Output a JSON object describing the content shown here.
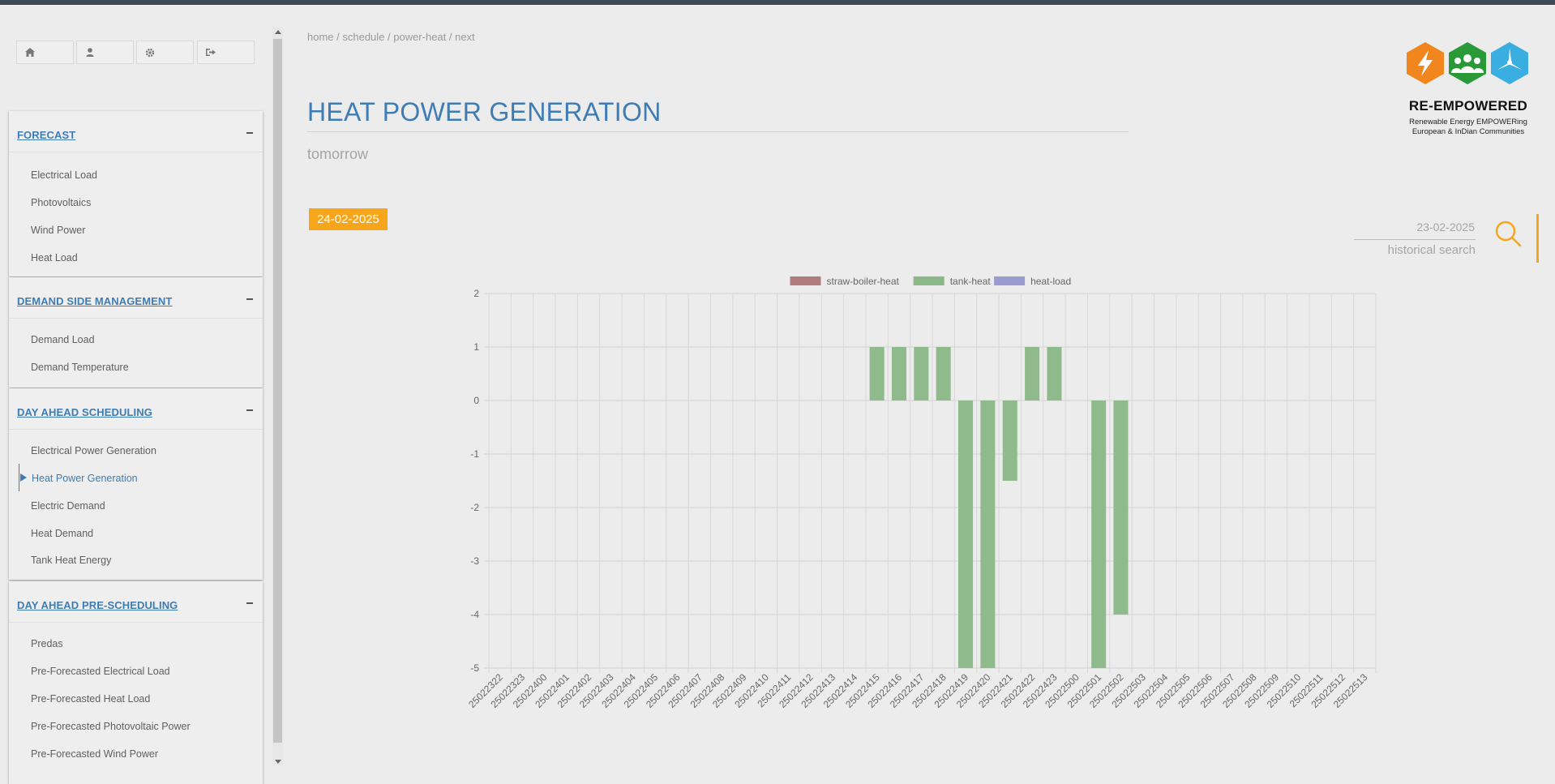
{
  "toolbar": {
    "buttons": [
      {
        "icon": "home-icon"
      },
      {
        "icon": "user-icon"
      },
      {
        "icon": "gear-icon"
      },
      {
        "icon": "sign-out-icon"
      }
    ]
  },
  "sidebar": {
    "sections": [
      {
        "title": "FORECAST",
        "items": [
          "Electrical Load",
          "Photovoltaics",
          "Wind Power",
          "Heat Load"
        ]
      },
      {
        "title": "DEMAND SIDE MANAGEMENT",
        "items": [
          "Demand Load",
          "Demand Temperature"
        ]
      },
      {
        "title": "DAY AHEAD SCHEDULING",
        "items": [
          "Electrical Power Generation",
          "Heat Power Generation",
          "Electric Demand",
          "Heat Demand",
          "Tank Heat Energy"
        ],
        "active": "Heat Power Generation"
      },
      {
        "title": "DAY AHEAD PRE-SCHEDULING",
        "items": [
          "Predas",
          "Pre-Forecasted Electrical Load",
          "Pre-Forecasted Heat Load",
          "Pre-Forecasted Photovoltaic Power",
          "Pre-Forecasted Wind Power"
        ]
      }
    ],
    "toggle_symbol": "−"
  },
  "breadcrumb": "home / schedule / power-heat / next",
  "page": {
    "title": "HEAT POWER GENERATION",
    "subtitle": "tomorrow",
    "date_badge": "24-02-2025"
  },
  "logo": {
    "name": "RE-EMPOWERED",
    "tagline_1": "Renewable Energy EMPOWERing",
    "tagline_2": "European & InDian Communities",
    "colors": [
      "#f0861d",
      "#2a9a38",
      "#3aaee0"
    ]
  },
  "historical": {
    "date": "23-02-2025",
    "label": "historical search",
    "accent": "#f7a51a"
  },
  "chart_data": {
    "type": "bar",
    "ylim": [
      -5,
      2
    ],
    "yticks": [
      2,
      1,
      0,
      -1,
      -2,
      -3,
      -4,
      -5
    ],
    "grid": true,
    "legend_position": "top",
    "categories": [
      "25022322",
      "25022323",
      "25022400",
      "25022401",
      "25022402",
      "25022403",
      "25022404",
      "25022405",
      "25022406",
      "25022407",
      "25022408",
      "25022409",
      "25022410",
      "25022411",
      "25022412",
      "25022413",
      "25022414",
      "25022415",
      "25022416",
      "25022417",
      "25022418",
      "25022419",
      "25022420",
      "25022421",
      "25022422",
      "25022423",
      "25022500",
      "25022501",
      "25022502",
      "25022503",
      "25022504",
      "25022505",
      "25022506",
      "25022507",
      "25022508",
      "25022509",
      "25022510",
      "25022511",
      "25022512",
      "25022513"
    ],
    "series": [
      {
        "name": "straw-boiler-heat",
        "color": "#b07c7c",
        "values": [
          0,
          0,
          0,
          0,
          0,
          0,
          0,
          0,
          0,
          0,
          0,
          0,
          0,
          0,
          0,
          0,
          0,
          0,
          0,
          0,
          0,
          0,
          0,
          0,
          0,
          0,
          0,
          0,
          0,
          0,
          0,
          0,
          0,
          0,
          0,
          0,
          0,
          0,
          0,
          0
        ]
      },
      {
        "name": "tank-heat",
        "color": "#8ab887",
        "values": [
          0,
          0,
          0,
          0,
          0,
          0,
          0,
          0,
          0,
          0,
          0,
          0,
          0,
          0,
          0,
          0,
          0,
          1,
          1,
          1,
          1,
          -5,
          -5,
          -1.5,
          1,
          1,
          0,
          -5,
          -4,
          0,
          0,
          0,
          0,
          0,
          0,
          0,
          0,
          0,
          0,
          0
        ]
      },
      {
        "name": "heat-load",
        "color": "#9a9bd0",
        "values": [
          0,
          0,
          0,
          0,
          0,
          0,
          0,
          0,
          0,
          0,
          0,
          0,
          0,
          0,
          0,
          0,
          0,
          0,
          0,
          0,
          0,
          0,
          0,
          0,
          0,
          0,
          0,
          0,
          0,
          0,
          0,
          0,
          0,
          0,
          0,
          0,
          0,
          0,
          0,
          0
        ]
      }
    ]
  }
}
